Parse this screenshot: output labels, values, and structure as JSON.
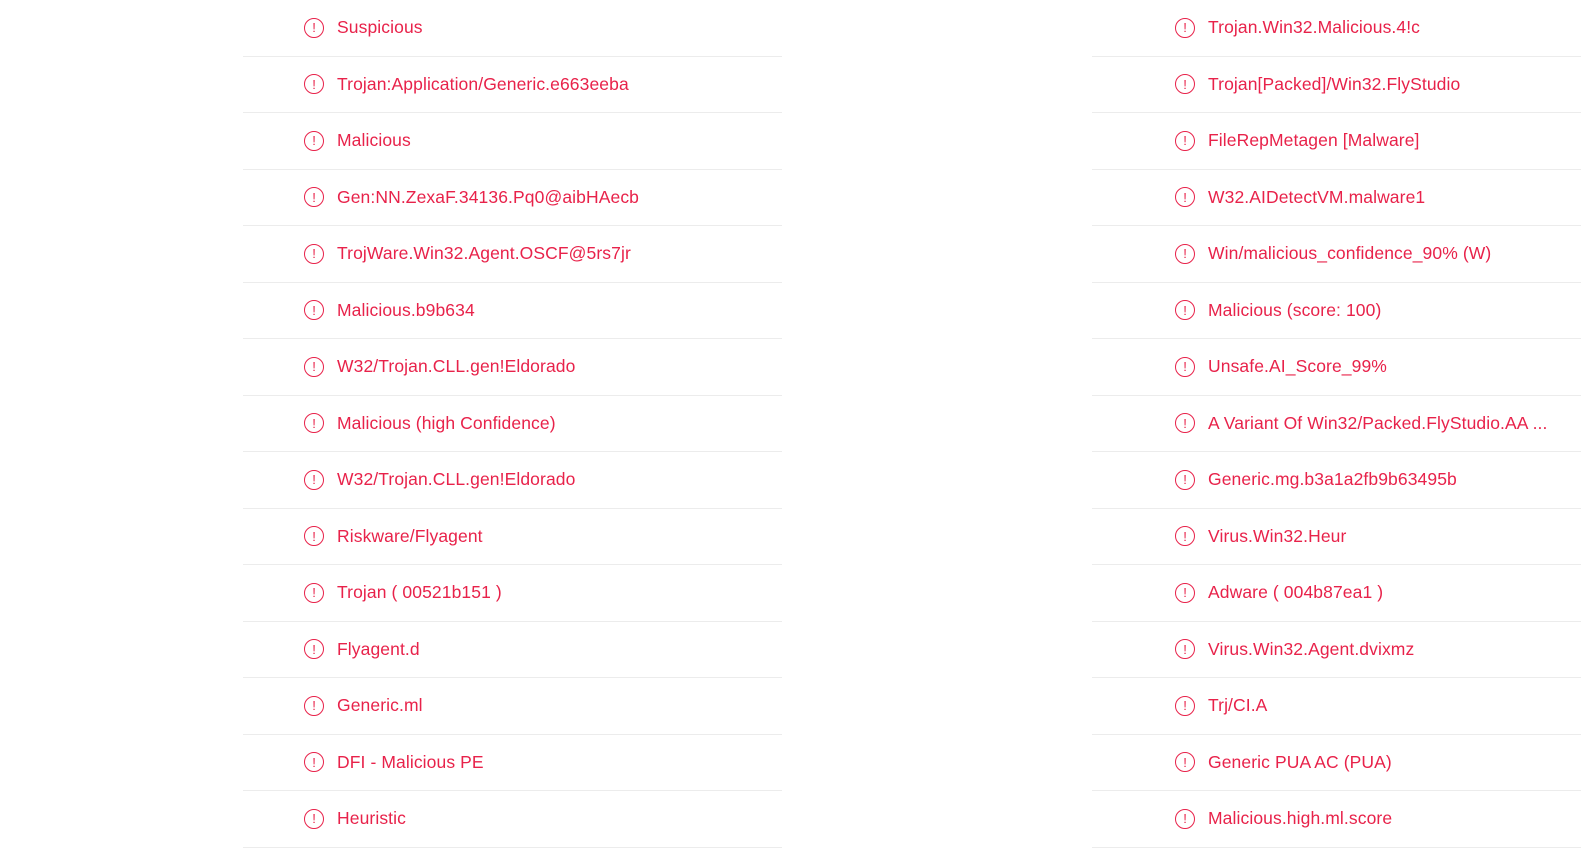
{
  "accent_color": "#e8224a",
  "row_icon": "exclamation-circle-icon",
  "left_detections": [
    "Suspicious",
    "Trojan:Application/Generic.e663eeba",
    "Malicious",
    "Gen:NN.ZexaF.34136.Pq0@aibHAecb",
    "TrojWare.Win32.Agent.OSCF@5rs7jr",
    "Malicious.b9b634",
    "W32/Trojan.CLL.gen!Eldorado",
    "Malicious (high Confidence)",
    "W32/Trojan.CLL.gen!Eldorado",
    "Riskware/Flyagent",
    "Trojan ( 00521b151 )",
    "Flyagent.d",
    "Generic.ml",
    "DFI - Malicious PE",
    "Heuristic"
  ],
  "right_detections": [
    "Trojan.Win32.Malicious.4!c",
    "Trojan[Packed]/Win32.FlyStudio",
    "FileRepMetagen [Malware]",
    "W32.AIDetectVM.malware1",
    "Win/malicious_confidence_90% (W)",
    "Malicious (score: 100)",
    "Unsafe.AI_Score_99%",
    "A Variant Of Win32/Packed.FlyStudio.AA ...",
    "Generic.mg.b3a1a2fb9b63495b",
    "Virus.Win32.Heur",
    "Adware ( 004b87ea1 )",
    "Virus.Win32.Agent.dvixmz",
    "Trj/CI.A",
    "Generic PUA AC (PUA)",
    "Malicious.high.ml.score"
  ]
}
